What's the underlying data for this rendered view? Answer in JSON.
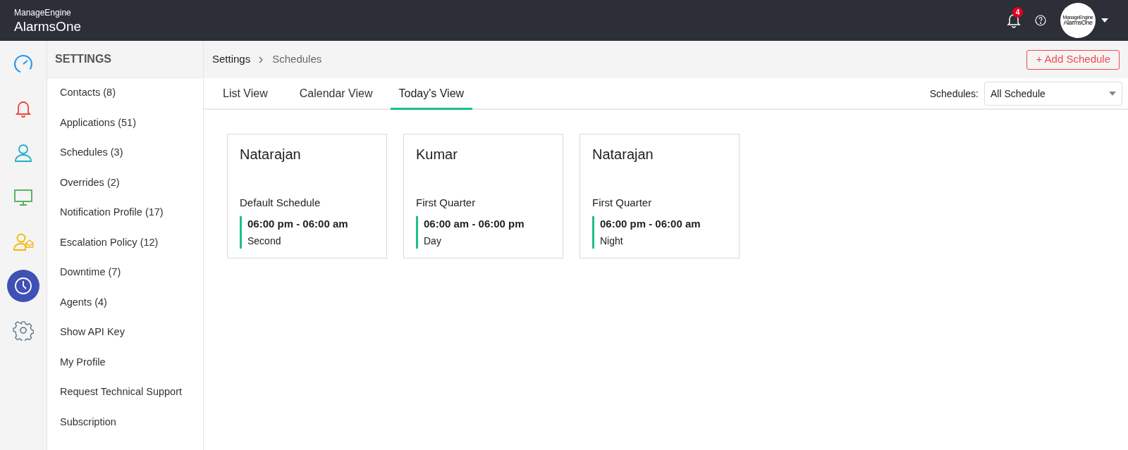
{
  "header": {
    "brand": "ManageEngine",
    "product": "AlarmsOne",
    "notification_count": "4",
    "avatar": {
      "brand": "ManageEngine",
      "product": "AlarmsOne"
    }
  },
  "rail": [
    {
      "kind": "dashboard",
      "selected": false
    },
    {
      "kind": "alarms",
      "selected": false
    },
    {
      "kind": "users",
      "selected": false
    },
    {
      "kind": "monitor",
      "selected": false
    },
    {
      "kind": "contact-mail",
      "selected": false
    },
    {
      "kind": "schedule",
      "selected": true
    },
    {
      "kind": "settings",
      "selected": false
    }
  ],
  "sidebar": {
    "title": "SETTINGS",
    "items": [
      "Contacts (8)",
      "Applications (51)",
      "Schedules (3)",
      "Overrides (2)",
      "Notification Profile (17)",
      "Escalation Policy (12)",
      "Downtime (7)",
      "Agents (4)",
      "Show API Key",
      "My Profile",
      "Request Technical Support",
      "Subscription"
    ]
  },
  "breadcrumb": [
    "Settings",
    "Schedules"
  ],
  "add_button": "+ Add Schedule",
  "tabs": [
    {
      "label": "List View",
      "selected": false
    },
    {
      "label": "Calendar View",
      "selected": false
    },
    {
      "label": "Today's View",
      "selected": true
    }
  ],
  "filter": {
    "label": "Schedules:",
    "value": "All Schedule"
  },
  "cards": [
    {
      "name": "Natarajan",
      "schedule": "Default Schedule",
      "time": "06:00 pm - 06:00 am",
      "shift": "Second"
    },
    {
      "name": "Kumar",
      "schedule": "First Quarter",
      "time": "06:00 am - 06:00 pm",
      "shift": "Day"
    },
    {
      "name": "Natarajan",
      "schedule": "First Quarter",
      "time": "06:00 pm - 06:00 am",
      "shift": "Night"
    }
  ]
}
